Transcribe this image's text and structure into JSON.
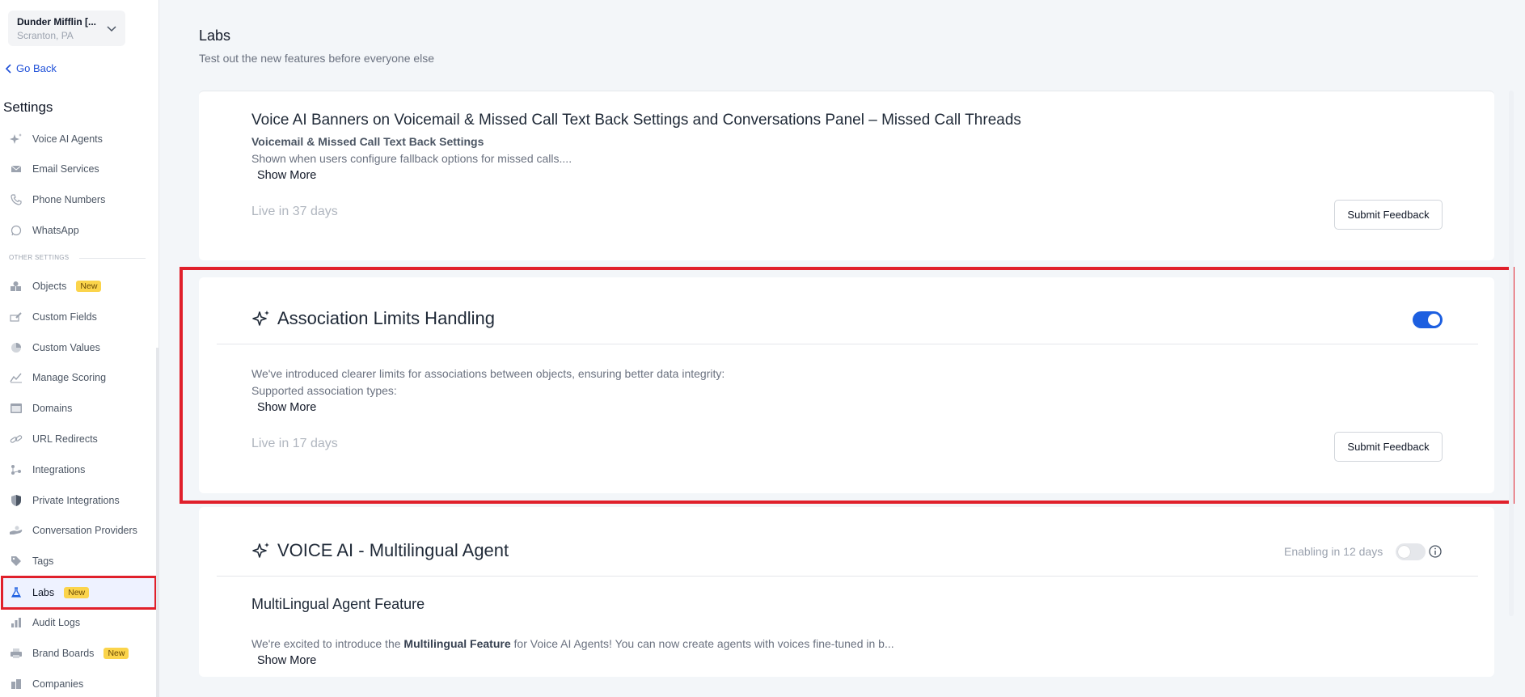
{
  "account": {
    "name": "Dunder Mifflin [...",
    "location": "Scranton, PA"
  },
  "nav": {
    "go_back": "Go Back",
    "settings_title": "Settings",
    "section_other": "OTHER SETTINGS",
    "items": [
      {
        "label": "Voice AI Agents",
        "icon": "sparkle-icon"
      },
      {
        "label": "Email Services",
        "icon": "envelope-icon"
      },
      {
        "label": "Phone Numbers",
        "icon": "phone-icon"
      },
      {
        "label": "WhatsApp",
        "icon": "whatsapp-icon"
      },
      {
        "label": "Objects",
        "icon": "shapes-icon",
        "badge": "New"
      },
      {
        "label": "Custom Fields",
        "icon": "edit-field-icon"
      },
      {
        "label": "Custom Values",
        "icon": "pie-icon"
      },
      {
        "label": "Manage Scoring",
        "icon": "chart-line-icon"
      },
      {
        "label": "Domains",
        "icon": "browser-icon"
      },
      {
        "label": "URL Redirects",
        "icon": "link-icon"
      },
      {
        "label": "Integrations",
        "icon": "integrations-icon"
      },
      {
        "label": "Private Integrations",
        "icon": "shield-icon"
      },
      {
        "label": "Conversation Providers",
        "icon": "hand-icon"
      },
      {
        "label": "Tags",
        "icon": "tag-icon"
      },
      {
        "label": "Labs",
        "icon": "flask-icon",
        "badge": "New",
        "active": true
      },
      {
        "label": "Audit Logs",
        "icon": "bar-chart-icon"
      },
      {
        "label": "Brand Boards",
        "icon": "printer-icon",
        "badge": "New"
      },
      {
        "label": "Companies",
        "icon": "building-icon"
      }
    ]
  },
  "main": {
    "title": "Labs",
    "subtitle": "Test out the new features before everyone else",
    "cards": [
      {
        "title": "Voice AI Banners on Voicemail & Missed Call Text Back Settings and Conversations Panel – Missed Call Threads",
        "subtitle": "Voicemail & Missed Call Text Back Settings",
        "description": "Shown when users configure fallback options for missed calls....",
        "show_more": "Show More",
        "live": "Live in 37 days",
        "feedback": "Submit Feedback"
      },
      {
        "title": "Association Limits Handling",
        "toggle": "on",
        "description_1": "We've introduced clearer limits for associations between objects, ensuring better data integrity:",
        "description_2": "Supported association types:",
        "show_more": "Show More",
        "live": "Live in 17 days",
        "feedback": "Submit Feedback"
      },
      {
        "title": "VOICE AI - Multilingual Agent",
        "enabling": "Enabling in 12 days",
        "toggle": "off",
        "subtitle": "MultiLingual Agent Feature",
        "description_pre": "We're excited to introduce the ",
        "description_bold": "Multilingual Feature",
        "description_post": " for Voice AI Agents! You can now create agents with voices fine-tuned in b...",
        "show_more": "Show More"
      }
    ]
  },
  "colors": {
    "accent": "#1d5fe0",
    "highlight": "#e0202b",
    "badge": "#fbd44b"
  }
}
